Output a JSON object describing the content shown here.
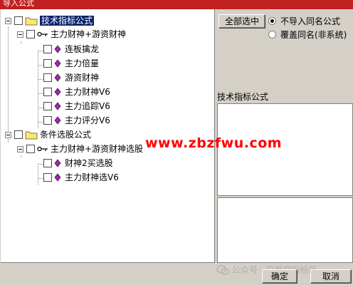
{
  "window": {
    "title": "导入公式"
  },
  "tree": {
    "nodes": [
      {
        "label": "技术指标公式",
        "type": "folder",
        "selected": true
      },
      {
        "label": "主力财神+游资财神",
        "type": "group"
      },
      {
        "label": "连板擒龙",
        "type": "formula"
      },
      {
        "label": "主力倍量",
        "type": "formula"
      },
      {
        "label": "游资财神",
        "type": "formula"
      },
      {
        "label": "主力财神V6",
        "type": "formula"
      },
      {
        "label": "主力追踪V6",
        "type": "formula"
      },
      {
        "label": "主力评分V6",
        "type": "formula"
      },
      {
        "label": "条件选股公式",
        "type": "folder"
      },
      {
        "label": "主力财神+游资财神选股",
        "type": "group"
      },
      {
        "label": "财神2买选股",
        "type": "formula"
      },
      {
        "label": "主力财神选V6",
        "type": "formula"
      }
    ]
  },
  "right_panel": {
    "select_all_label": "全部选中",
    "radio_options": [
      {
        "label": "不导入同名公式",
        "checked": true
      },
      {
        "label": "覆盖同名(非系统)",
        "checked": false
      }
    ],
    "info_label": "技术指标公式"
  },
  "footer": {
    "ok_label": "确定",
    "cancel_label": "取消"
  },
  "watermark": {
    "site": "www.zbzfwu.com",
    "wechat": "公众号 · 司晨空指标所"
  },
  "colors": {
    "title_bar": "#c0201f",
    "selection": "#0a246a",
    "folder": "#f7e77a",
    "diamond": "#9b2ca8",
    "watermark": "#ff0000"
  }
}
